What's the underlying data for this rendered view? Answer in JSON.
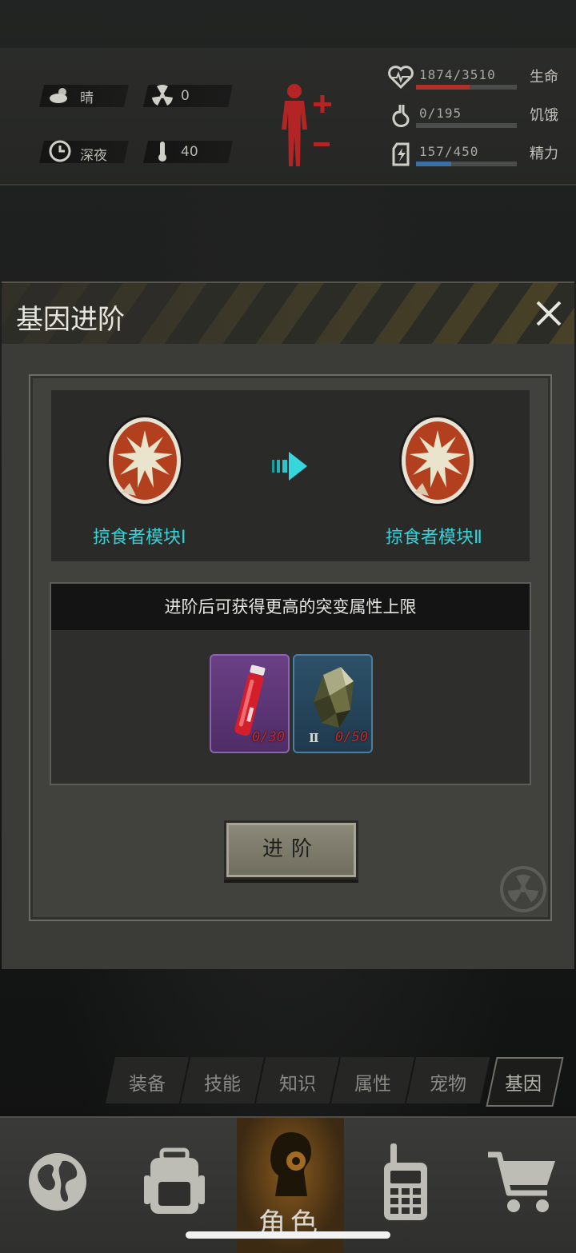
{
  "status": {
    "weather": "晴",
    "radiation": "0",
    "time_of_day": "深夜",
    "temperature": "40",
    "health": {
      "text": "1874/3510",
      "name": "生命",
      "fill": 0.534,
      "color": "#b0302a"
    },
    "hunger": {
      "text": "0/195",
      "name": "饥饿",
      "fill": 0.0,
      "color": "#7b7b76"
    },
    "energy": {
      "text": "157/450",
      "name": "精力",
      "fill": 0.349,
      "color": "#3a6fa8"
    }
  },
  "dialog": {
    "title": "基因进阶",
    "from_module": "掠食者模块Ⅰ",
    "to_module": "掠食者模块Ⅱ",
    "requirement_text": "进阶后可获得更高的突变属性上限",
    "items": [
      {
        "icon": "red-vial-icon",
        "count": "0/30",
        "tier": ""
      },
      {
        "icon": "ore-crystal-icon",
        "count": "0/50",
        "tier": "Ⅱ"
      }
    ],
    "advance_label": "进阶"
  },
  "tabs": [
    "装备",
    "技能",
    "知识",
    "属性",
    "宠物",
    "基因"
  ],
  "active_tab": "基因",
  "nav": {
    "active_label": "角色",
    "items": [
      "globe-icon",
      "backpack-icon",
      "character-icon",
      "radio-icon",
      "cart-icon"
    ]
  }
}
